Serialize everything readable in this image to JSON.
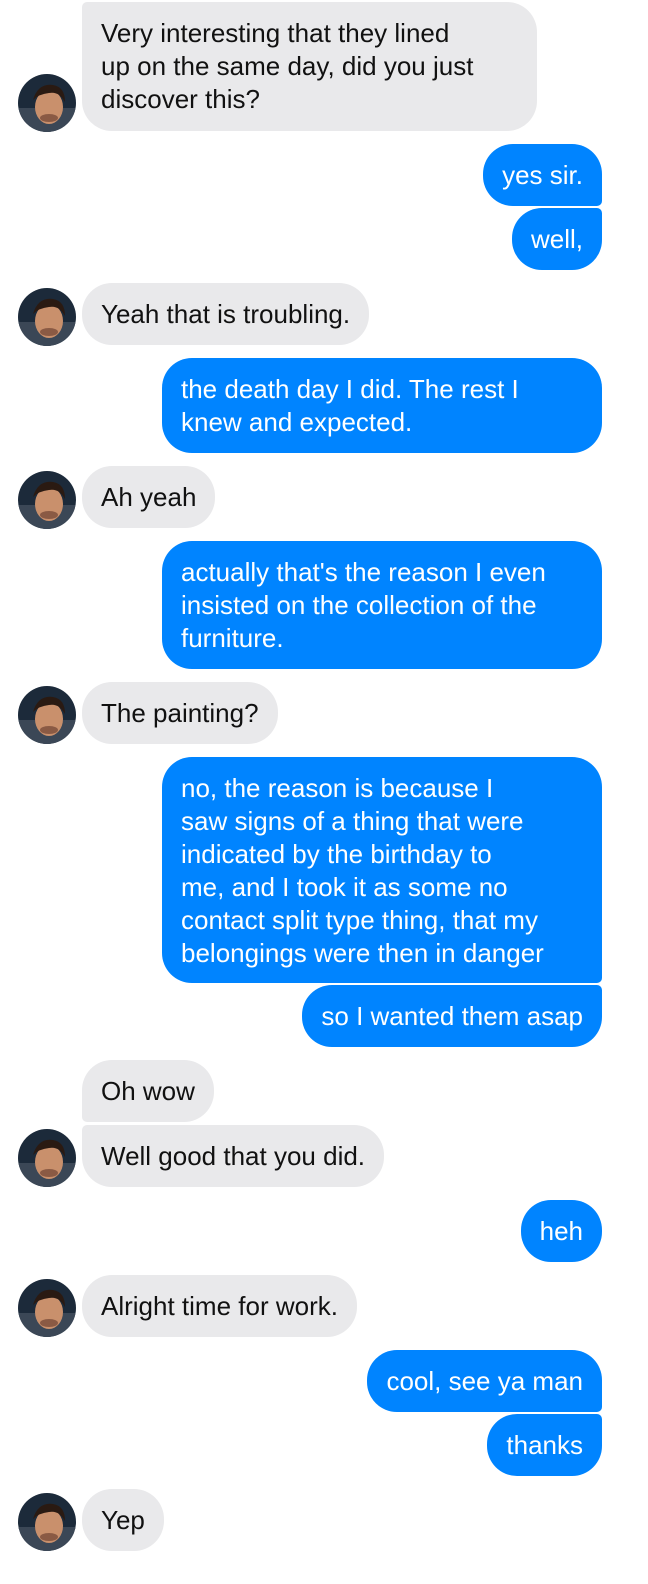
{
  "conversation": {
    "messages": [
      {
        "from": "them",
        "text": "Very interesting that they lined\nup on the same day, did you just\ndiscover this?"
      },
      {
        "from": "me",
        "text": "yes sir."
      },
      {
        "from": "me",
        "text": "well,"
      },
      {
        "from": "them",
        "text": "Yeah that is troubling."
      },
      {
        "from": "me",
        "text": "the death day I did. The rest I\nknew and expected."
      },
      {
        "from": "them",
        "text": "Ah yeah"
      },
      {
        "from": "me",
        "text": "actually that's the reason I even\ninsisted on the collection of the\nfurniture."
      },
      {
        "from": "them",
        "text": "The painting?"
      },
      {
        "from": "me",
        "text": "no, the reason is because I\nsaw signs of a thing that were\nindicated by the birthday to\nme, and I took it as some no\ncontact split type thing, that my\nbelongings were then in danger"
      },
      {
        "from": "me",
        "text": "so I wanted them asap"
      },
      {
        "from": "them",
        "text": "Oh wow"
      },
      {
        "from": "them",
        "text": "Well good that you did."
      },
      {
        "from": "me",
        "text": "heh"
      },
      {
        "from": "them",
        "text": "Alright time for work."
      },
      {
        "from": "me",
        "text": "cool, see ya man"
      },
      {
        "from": "me",
        "text": "thanks"
      },
      {
        "from": "them",
        "text": "Yep"
      }
    ]
  },
  "colors": {
    "outgoing_bubble": "#0084ff",
    "incoming_bubble": "#e9e9eb",
    "outgoing_text": "#ffffff",
    "incoming_text": "#111111"
  },
  "icons": {
    "contact_avatar": "avatar-icon"
  }
}
